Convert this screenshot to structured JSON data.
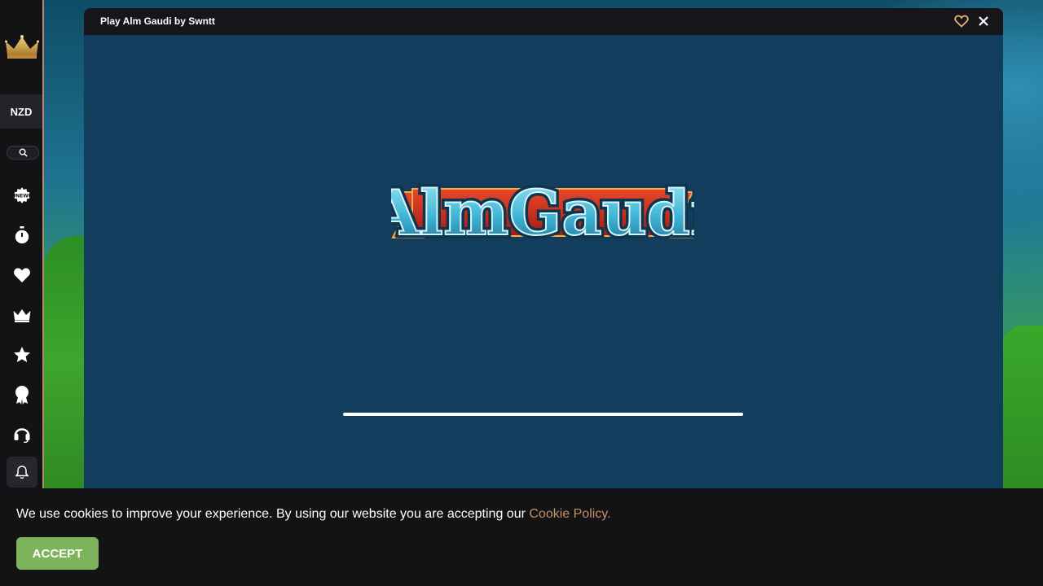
{
  "sidebar": {
    "currency": "NZD",
    "icons": [
      "crown-logo-icon",
      "search-icon",
      "new-badge-icon",
      "stopwatch-icon",
      "heart-icon",
      "crown-icon",
      "star-icon",
      "award-icon",
      "headset-icon",
      "bell-icon"
    ]
  },
  "game_window": {
    "title": "Play Alm Gaudi by Swntt",
    "logo_text": "AlmGaudi",
    "loading_progress": 1.0
  },
  "cookie_bar": {
    "text": "We use cookies to improve your experience. By using our website you are accepting our ",
    "link_text": "Cookie Policy.",
    "accept_label": "ACCEPT"
  },
  "colors": {
    "sidebar_bg": "#131316",
    "accent_gold": "#c48f63",
    "game_bg": "#123d5c",
    "accept_green": "#7cb35c"
  }
}
